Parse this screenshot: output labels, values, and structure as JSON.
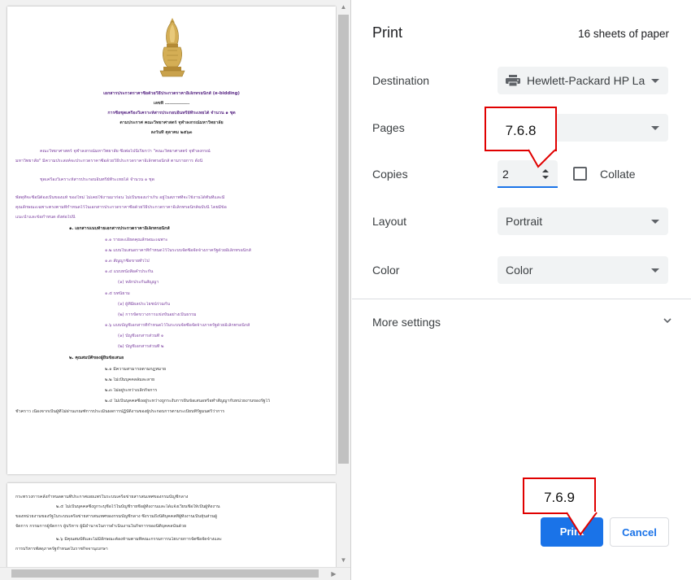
{
  "preview": {
    "page1": {
      "heading_lines": [
        "เอกสารประกวดราคาซื้อด้วยวิธีประกวดราคาอิเล็กทรอนิกส์ (e-bidding)",
        "เลขที่ ...............",
        "การซื้อชุดเครื่องวิเคราะห์สารประกอบอินทรีย์ที่ระเหยได้ จำนวน ๑ ชุด",
        "ตามประกาศ คณะวิทยาศาสตร์ จุฬาลงกรณ์มหาวิทยาลัย",
        "ลงวันที่ ตุลาคม ๒๕๖๓"
      ],
      "intro_lines": [
        "คณะวิทยาศาสตร์ จุฬาลงกรณ์มหาวิทยาลัย ซึ่งต่อไปนี้เรียกว่า \"คณะวิทยาศาสตร์ จุฬาลงกรณ์",
        "มหาวิทยาลัย\" มีความประสงค์จะประกวดราคาซื้อด้วยวิธีประกวดราคาอิเล็กทรอนิกส์ ตามรายการ ดังนี้",
        "ชุดเครื่องวิเคราะห์สารประกอบอินทรีย์ที่ระเหยได้ จำนวน ๑ ชุด",
        "พัสดุที่จะซื้อนี้ต้องเป็นของแท้ ของใหม่ ไม่เคยใช้งานมาก่อน ไม่เป็นของเก่าเก็บ อยู่ในสภาพที่จะใช้งานได้ทันทีและมี",
        "คุณลักษณะเฉพาะตรงตามที่กำหนดไว้ในเอกสารประกวดราคาซื้อด้วยวิธีประกวดราคาอิเล็กทรอนิกส์ฉบับนี้ โดยมีข้อ",
        "แนะนำและข้อกำหนด ดังต่อไปนี้"
      ],
      "list_lines": [
        "๑. เอกสารแนบท้ายเอกสารประกวดราคาอิเล็กทรอนิกส์",
        "๑.๑ รายละเอียดคุณลักษณะเฉพาะ",
        "๑.๒ แบบใบเสนอราคาที่กำหนดไว้ในระบบจัดซื้อจัดจ้างภาครัฐด้วยอิเล็กทรอนิกส์",
        "๑.๓ สัญญาซื้อขายทั่วไป",
        "๑.๔ แบบหนังสือค้ำประกัน",
        "(๑) หลักประกันสัญญา",
        "๑.๕ บทนิยาม",
        "(๑) ผู้ที่มีผลประโยชน์ร่วมกัน",
        "(๒) การขัดขวางการแข่งขันอย่างเป็นธรรม",
        "๑.๖ แบบบัญชีเอกสารที่กำหนดไว้ในระบบจัดซื้อจัดจ้างภาครัฐด้วยอิเล็กทรอนิกส์",
        "(๑) บัญชีเอกสารส่วนที่ ๑",
        "(๒) บัญชีเอกสารส่วนที่ ๒",
        "๒. คุณสมบัติของผู้ยื่นข้อเสนอ",
        "๒.๑ มีความสามารถตามกฎหมาย",
        "๒.๒ ไม่เป็นบุคคลล้มละลาย",
        "๒.๓ ไม่อยู่ระหว่างเลิกกิจการ",
        "๒.๔ ไม่เป็นบุคคลซึ่งอยู่ระหว่างถูกระงับการยื่นข้อเสนอหรือทำสัญญากับหน่วยงานของรัฐไว้",
        "ชั่วคราว เนื่องจากเป็นผู้ที่ไม่ผ่านเกณฑ์การประเมินผลการปฏิบัติงานของผู้ประกอบการตามระเบียบที่รัฐมนตรีว่าการ"
      ]
    },
    "page2": {
      "lines": [
        "กระทรวงการคลังกำหนดตามที่ประกาศเผยแพร่ในระบบเครือข่ายสารสนเทศของกรมบัญชีกลาง",
        "๒.๕ ไม่เป็นบุคคลซึ่งถูกระบุชื่อไว้ในบัญชีรายชื่อผู้ทิ้งงานและได้แจ้งเวียนชื่อให้เป็นผู้ทิ้งงาน",
        "ของหน่วยงานของรัฐในระบบเครือข่ายสารสนเทศของกรมบัญชีกลาง ซึ่งรวมถึงนิติบุคคลที่ผู้ทิ้งงานเป็นหุ้นส่วนผู้",
        "จัดการ กรรมการผู้จัดการ ผู้บริหาร ผู้มีอำนาจในการดำเนินงานในกิจการของนิติบุคคลนั้นด้วย",
        "๒.๖ มีคุณสมบัติและไม่มีลักษณะต้องห้ามตามที่คณะกรรมการนโยบายการจัดซื้อจัดจ้างและ",
        "การบริหารพัสดุภาครัฐกำหนดในราชกิจจานุเบกษา"
      ]
    }
  },
  "settings": {
    "title": "Print",
    "sheets": "16 sheets of paper",
    "destination": {
      "label": "Destination",
      "value": "Hewlett-Packard HP La",
      "icon": "printer-icon"
    },
    "pages": {
      "label": "Pages"
    },
    "copies": {
      "label": "Copies",
      "value": "2"
    },
    "collate": {
      "label": "Collate",
      "checked": false
    },
    "layout": {
      "label": "Layout",
      "value": "Portrait"
    },
    "color": {
      "label": "Color",
      "value": "Color"
    },
    "more_settings": {
      "label": "More settings"
    },
    "buttons": {
      "print": "Print",
      "cancel": "Cancel"
    },
    "accent_color": "#1a73e8"
  },
  "callouts": {
    "top": "7.6.8",
    "bottom": "7.6.9",
    "border_color": "#e00000"
  }
}
